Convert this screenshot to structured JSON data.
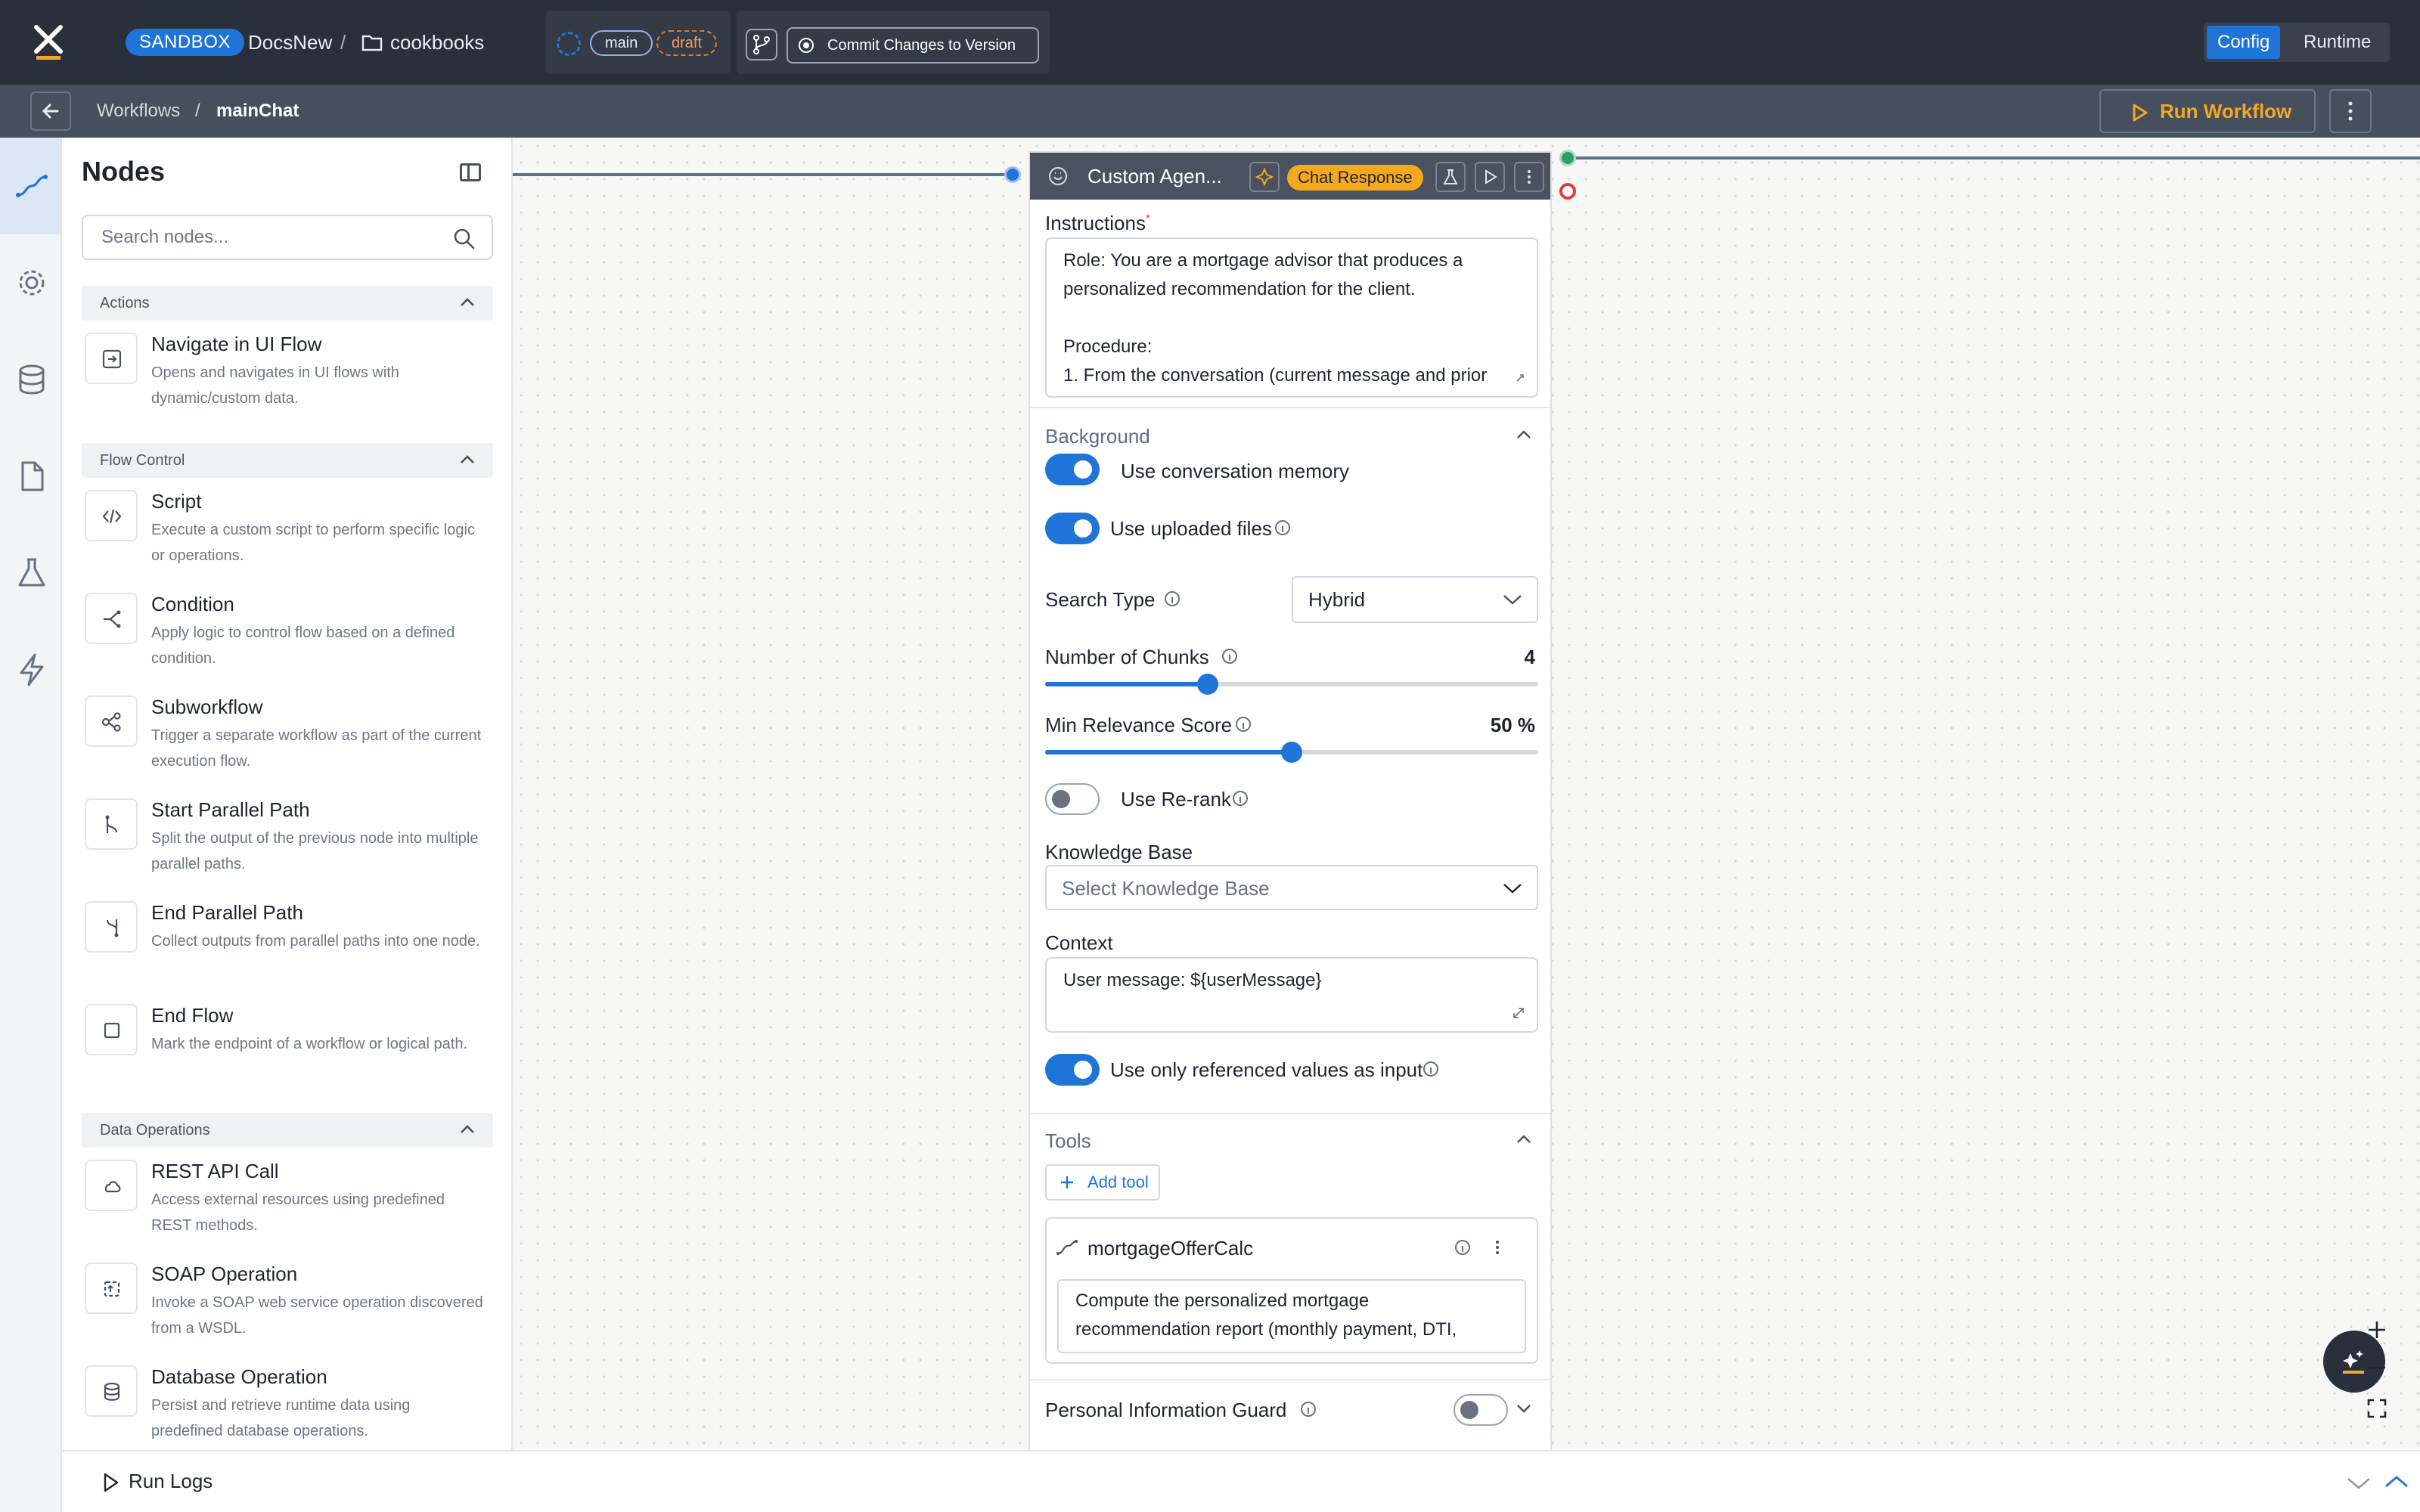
{
  "app": {
    "env_badge": "SANDBOX",
    "project": "DocsNew",
    "separator": "/",
    "folder": "cookbooks"
  },
  "branch": {
    "name": "main",
    "status": "draft",
    "commit_label": "Commit Changes to Version"
  },
  "mode_switch": {
    "config": "Config",
    "runtime": "Runtime",
    "active": "Config"
  },
  "breadcrumb": {
    "parent": "Workflows",
    "separator": "/",
    "current": "mainChat"
  },
  "actions": {
    "run_workflow": "Run Workflow"
  },
  "nodes_panel": {
    "title": "Nodes",
    "search_placeholder": "Search nodes...",
    "sections": [
      {
        "title": "Actions",
        "items": [
          {
            "name": "Navigate in UI Flow",
            "desc": "Opens and navigates in UI flows with dynamic/custom data.",
            "icon": "navigate-icon"
          }
        ]
      },
      {
        "title": "Flow Control",
        "items": [
          {
            "name": "Script",
            "desc": "Execute a custom script to perform specific logic or operations.",
            "icon": "code-icon"
          },
          {
            "name": "Condition",
            "desc": "Apply logic to control flow based on a defined condition.",
            "icon": "condition-icon"
          },
          {
            "name": "Subworkflow",
            "desc": "Trigger a separate workflow as part of the current execution flow.",
            "icon": "subworkflow-icon"
          },
          {
            "name": "Start Parallel Path",
            "desc": "Split the output of the previous node into multiple parallel paths.",
            "icon": "split-icon"
          },
          {
            "name": "End Parallel Path",
            "desc": "Collect outputs from parallel paths into one node.",
            "icon": "merge-icon"
          },
          {
            "name": "End Flow",
            "desc": "Mark the endpoint of a workflow or logical path.",
            "icon": "square-icon"
          }
        ]
      },
      {
        "title": "Data Operations",
        "items": [
          {
            "name": "REST API Call",
            "desc": "Access external resources using predefined REST methods.",
            "icon": "cloud-icon"
          },
          {
            "name": "SOAP Operation",
            "desc": "Invoke a SOAP web service operation discovered from a WSDL.",
            "icon": "soap-icon"
          },
          {
            "name": "Database Operation",
            "desc": "Persist and retrieve runtime data using predefined database operations.",
            "icon": "database-icon"
          }
        ]
      }
    ]
  },
  "node_card": {
    "title": "Custom Agen...",
    "response_badge": "Chat Response",
    "instructions_label": "Instructions",
    "required_mark": "*",
    "instructions_lines": [
      "Role: You are a mortgage advisor that produces a",
      "personalized recommendation for the client.",
      "",
      "Procedure:",
      "1. From the conversation (current message and prior"
    ],
    "background": {
      "title": "Background",
      "use_memory": "Use conversation memory",
      "use_files": "Use uploaded files",
      "search_type_label": "Search Type",
      "search_type_value": "Hybrid",
      "chunks_label": "Number of Chunks",
      "chunks_value": "4",
      "chunks_fraction": 0.33,
      "relevance_label": "Min Relevance Score",
      "relevance_value": "50 %",
      "relevance_fraction": 0.5,
      "rerank_label": "Use Re-rank",
      "kb_label": "Knowledge Base",
      "kb_placeholder": "Select Knowledge Base",
      "context_label": "Context",
      "context_value": "User message: ${userMessage}",
      "only_ref_label": "Use only referenced values as input"
    },
    "tools": {
      "title": "Tools",
      "add_label": "Add tool",
      "tool_name": "mortgageOfferCalc",
      "tool_desc_lines": [
        "Compute the personalized mortgage",
        "recommendation report (monthly payment, DTI,"
      ]
    },
    "pii": {
      "label": "Personal Information Guard"
    }
  },
  "bottom": {
    "run_logs": "Run Logs"
  },
  "colors": {
    "accent": "#1f74d8",
    "topbar": "#2a303b",
    "badge": "#f6a81c",
    "run": "#f5a623"
  }
}
